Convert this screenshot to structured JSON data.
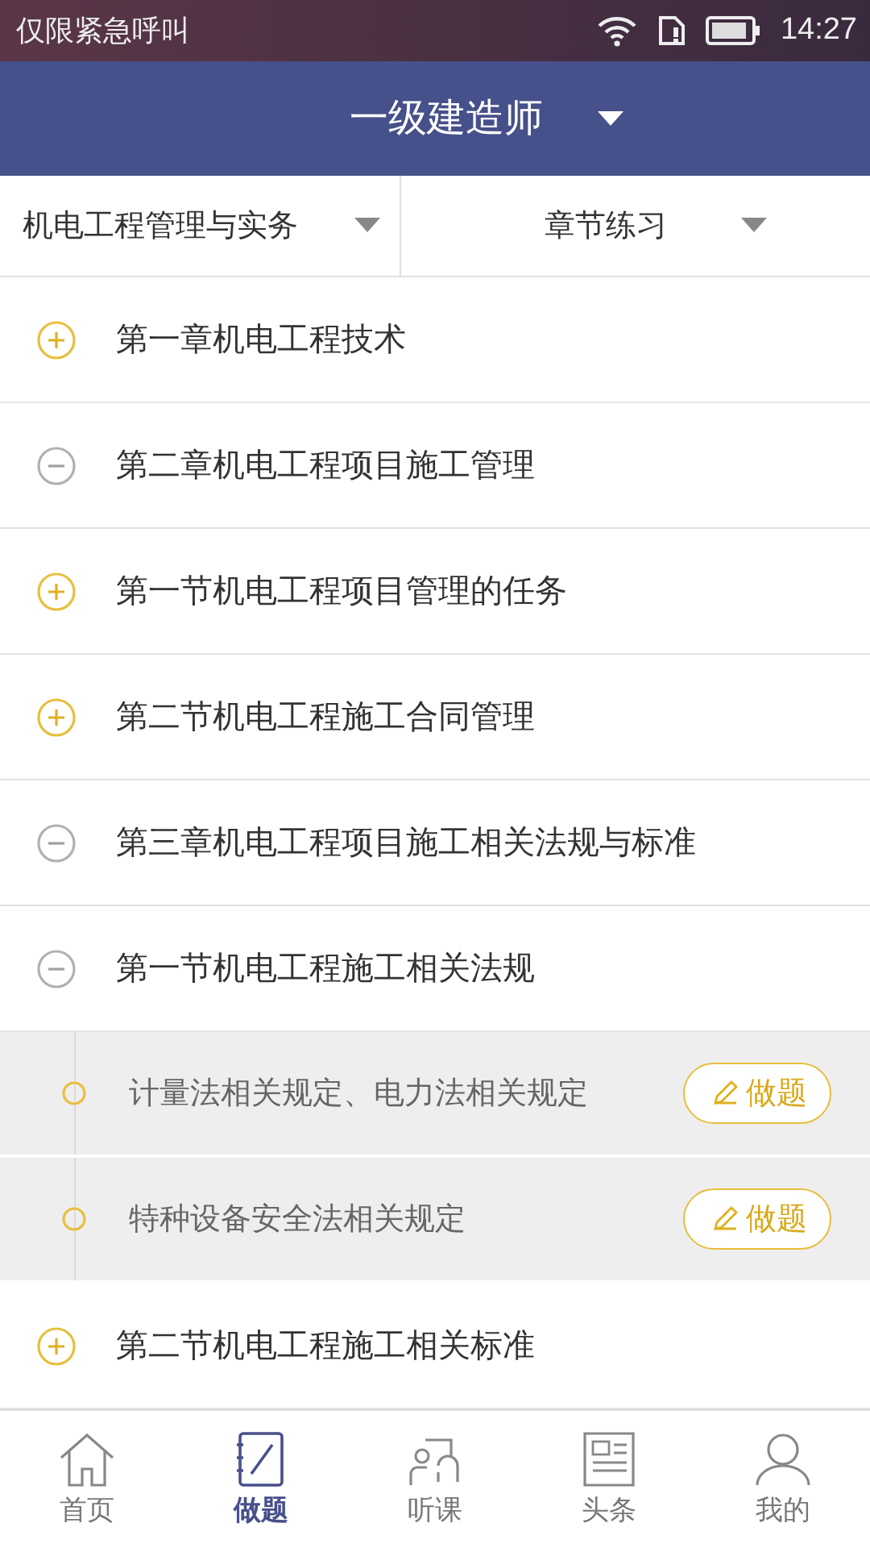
{
  "status_bar": {
    "carrier": "仅限紧急呼叫",
    "time": "14:27"
  },
  "header": {
    "title": "一级建造师"
  },
  "filters": [
    {
      "label": "机电工程管理与实务"
    },
    {
      "label": "章节练习"
    }
  ],
  "tree": [
    {
      "kind": "chapter",
      "title": "第一章机电工程技术",
      "expanded": false
    },
    {
      "kind": "chapter",
      "title": "第二章机电工程项目施工管理",
      "expanded": true,
      "children": [
        {
          "kind": "section",
          "title": "第一节机电工程项目管理的任务",
          "expanded": false
        },
        {
          "kind": "section",
          "title": "第二节机电工程施工合同管理",
          "expanded": false
        }
      ]
    },
    {
      "kind": "chapter",
      "title": "第三章机电工程项目施工相关法规与标准",
      "expanded": true,
      "children": [
        {
          "kind": "section",
          "title": "第一节机电工程施工相关法规",
          "expanded": true,
          "children": [
            {
              "kind": "topic",
              "title": "计量法相关规定、电力法相关规定",
              "action": "做题"
            },
            {
              "kind": "topic",
              "title": "特种设备安全法相关规定",
              "action": "做题"
            }
          ]
        },
        {
          "kind": "section",
          "title": "第二节机电工程施工相关标准",
          "expanded": false
        }
      ]
    }
  ],
  "tabs": [
    {
      "label": "首页",
      "selected": false
    },
    {
      "label": "做题",
      "selected": true
    },
    {
      "label": "听课",
      "selected": false
    },
    {
      "label": "头条",
      "selected": false
    },
    {
      "label": "我的",
      "selected": false
    }
  ]
}
